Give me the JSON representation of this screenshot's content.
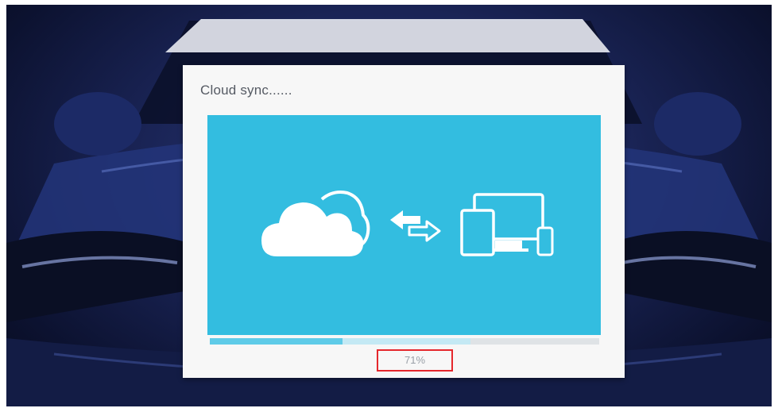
{
  "dialog": {
    "title": "Cloud sync......",
    "icons": [
      "cloud-icon",
      "sync-arrows-icon",
      "devices-icon"
    ],
    "progress": {
      "percent_label": "71%",
      "value": 0.34,
      "buffer": 0.67
    }
  },
  "colors": {
    "panel": "#33bde0",
    "progress_fill": "#5fcbe8",
    "highlight_box": "#e5272c"
  }
}
